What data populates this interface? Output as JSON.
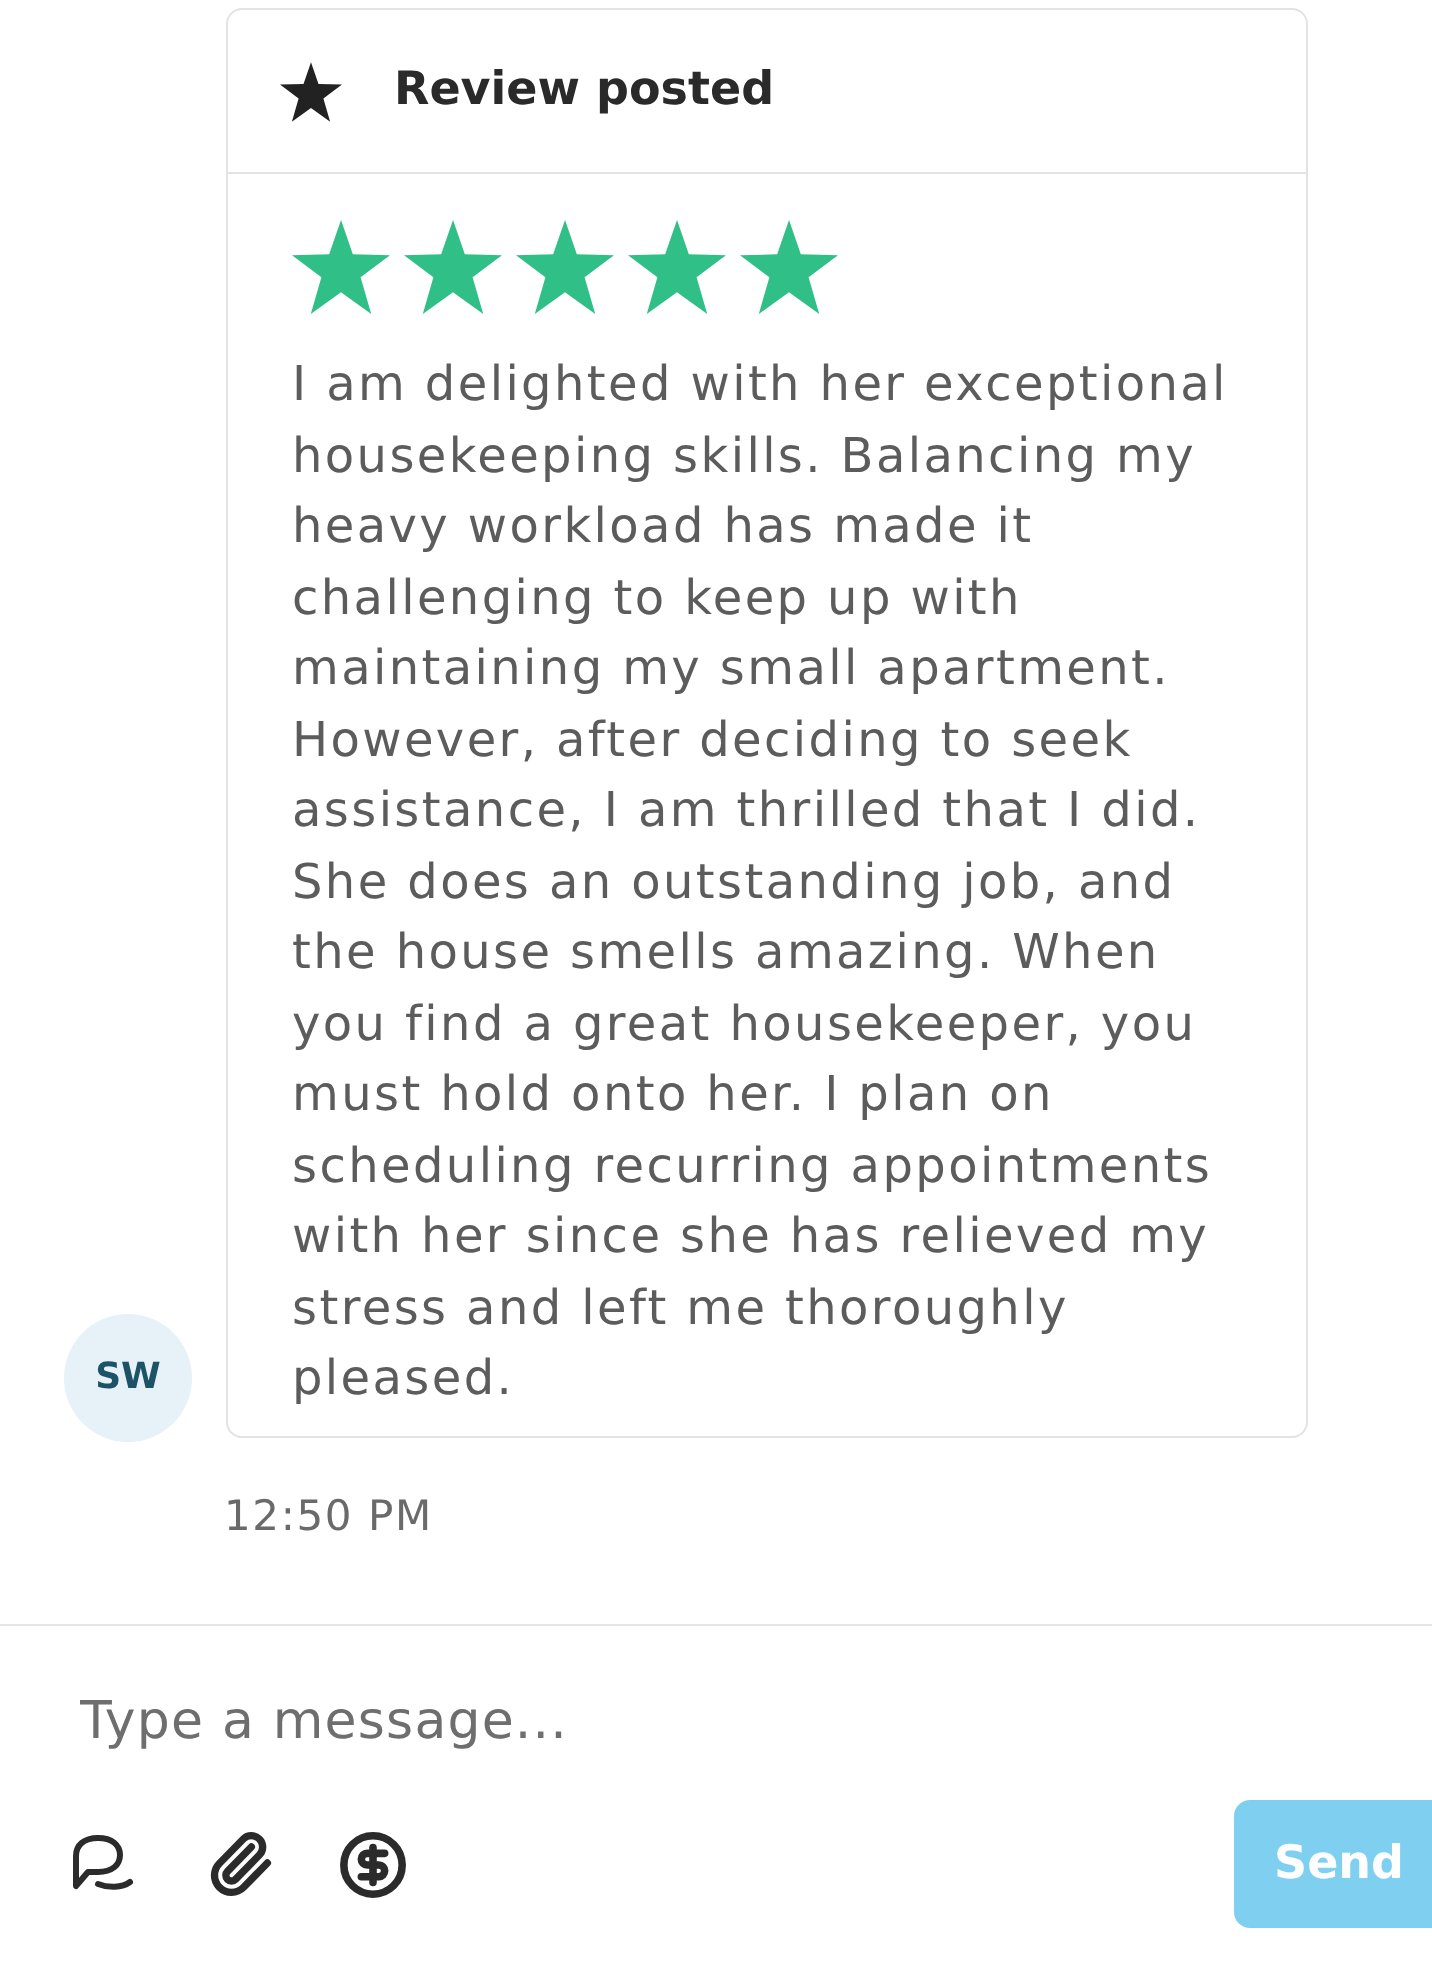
{
  "review_card": {
    "header_title": "Review posted",
    "stars": 5,
    "body": "I am delighted with her exceptional housekeeping skills. Balancing my heavy workload has made it challenging to keep up with maintaining my small apartment. However, after deciding to seek assistance, I am thrilled that I did. She does an outstanding job, and the house smells amazing. When you find a great housekeeper, you must hold onto her. I plan on scheduling recurring appointments with her since she has relieved my stress and left me thoroughly pleased."
  },
  "sender": {
    "initials": "SW"
  },
  "timestamp": "12:50 PM",
  "composer": {
    "placeholder": "Type a message...",
    "send_button": {
      "label": "Send",
      "disabled": true
    }
  }
}
